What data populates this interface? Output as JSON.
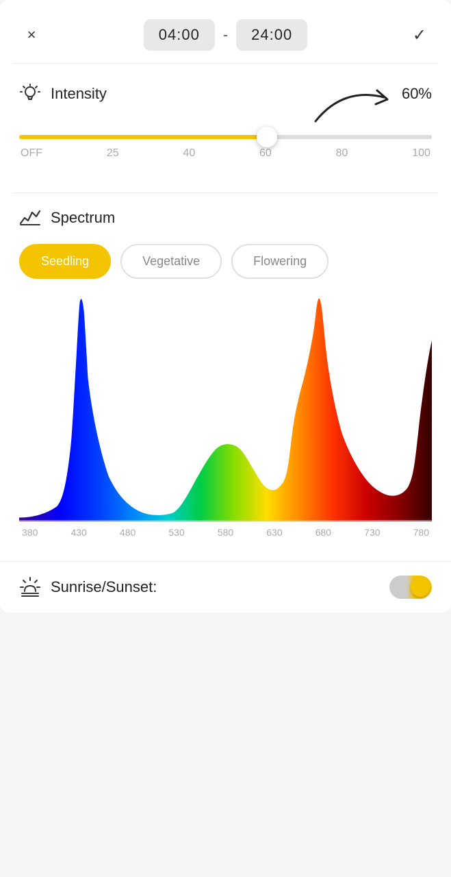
{
  "header": {
    "close_label": "×",
    "check_label": "✓",
    "time_start": "04:00",
    "time_end": "24:00",
    "separator": "-"
  },
  "intensity": {
    "title": "Intensity",
    "value": "60%",
    "slider_percent": 60,
    "labels": [
      "OFF",
      "25",
      "40",
      "60",
      "80",
      "100"
    ]
  },
  "spectrum": {
    "title": "Spectrum",
    "buttons": [
      "Seedling",
      "Vegetative",
      "Flowering"
    ],
    "active_button": "Seedling",
    "chart_labels": [
      "380",
      "430",
      "480",
      "530",
      "580",
      "630",
      "680",
      "730",
      "780"
    ]
  },
  "sunrise": {
    "title": "Sunrise/Sunset:",
    "toggle_on": true
  }
}
